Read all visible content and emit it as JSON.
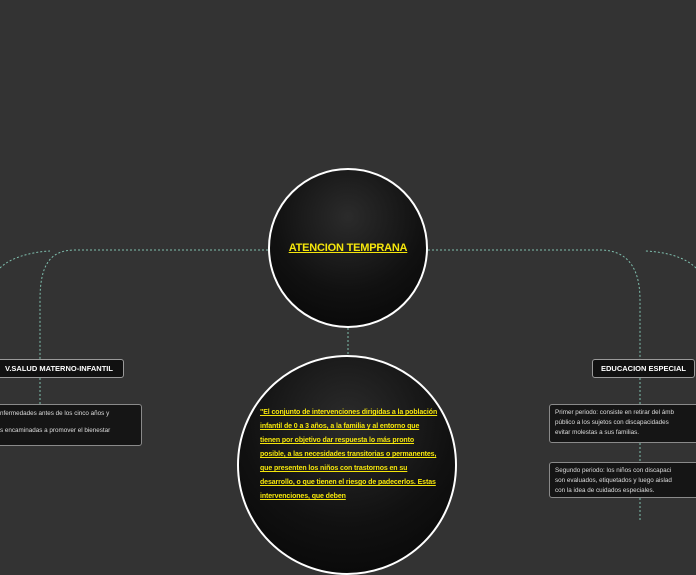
{
  "central_topic": {
    "title": "ATENCION TEMPRANA"
  },
  "main_topic": {
    "text": "\"El conjunto de intervenciones dirigidas a la población infantil de 0 a 3 años, a la familia y al entorno que tienen por objetivo dar respuesta lo más pronto posible, a las necesidades transitorias o permanentes, que presenten los niños con trastornos en su desarrollo, o que tienen el riesgo de padecerlos. Estas intervenciones, que deben"
  },
  "branches": {
    "left": {
      "label": "V.SALUD MATERNO-INFANTIL",
      "note_lines": [
        "nfermedades antes de los cinco años y",
        "s encaminadas a promover el bienestar"
      ]
    },
    "right": {
      "label": "EDUCACION ESPECIAL",
      "notes": [
        {
          "lines": [
            "Primer periodo: consiste en retirar del ámb",
            "público a los sujetos con discapacidades",
            "evitar molestas a sus familias."
          ]
        },
        {
          "lines": [
            "Segundo periodo: los niños con discapaci",
            "son evaluados, etiquetados y luego aislad",
            "con la idea de cuidados especiales."
          ]
        }
      ]
    }
  },
  "colors": {
    "background": "#333333",
    "topic_text": "#f5e60b",
    "connector": "#7fbfae",
    "border": "#ffffff"
  }
}
